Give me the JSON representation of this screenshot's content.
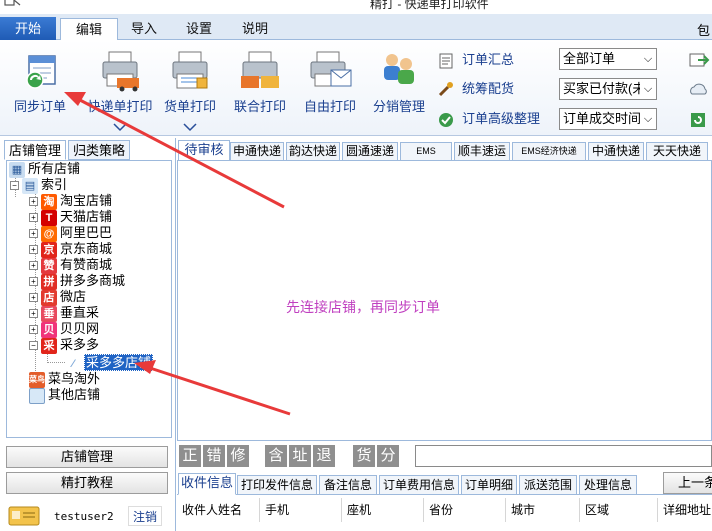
{
  "window": {
    "title": "精打 - 快递单打印软件"
  },
  "menubar": {
    "start": "开始",
    "tabs": [
      {
        "label": "编辑"
      },
      {
        "label": "导入"
      },
      {
        "label": "设置"
      },
      {
        "label": "说明"
      }
    ],
    "more": "包"
  },
  "ribbon": {
    "sync_order": "同步订单",
    "express_print": "快递单打印",
    "delivery_print": "货单打印",
    "combined_print": "联合打印",
    "free_print": "自由打印",
    "distribution": "分销管理",
    "order_summary": "订单汇总",
    "unified_picking": "统筹配货",
    "advanced_order": "订单高级整理",
    "filter_scope": "全部订单",
    "filter_status": "买家已付款(未",
    "filter_time": "订单成交时间,"
  },
  "left_panel": {
    "tabs": [
      "店铺管理",
      "归类策略"
    ],
    "tree": {
      "root": "所有店铺",
      "index": "索引",
      "shops": [
        {
          "label": "淘宝店铺",
          "icon": "taobao-icon",
          "glyph": "淘",
          "color": "#ff5a00"
        },
        {
          "label": "天猫店铺",
          "icon": "tmall-icon",
          "glyph": "T",
          "color": "#d40000"
        },
        {
          "label": "阿里巴巴",
          "icon": "alibaba-icon",
          "glyph": "@",
          "color": "#ff6a00"
        },
        {
          "label": "京东商城",
          "icon": "jd-icon",
          "glyph": "京",
          "color": "#e1251b"
        },
        {
          "label": "有赞商城",
          "icon": "youzan-icon",
          "glyph": "赞",
          "color": "#e4393c"
        },
        {
          "label": "拼多多商城",
          "icon": "pinduoduo-icon",
          "glyph": "拼",
          "color": "#e02e24"
        },
        {
          "label": "微店",
          "icon": "weidian-icon",
          "glyph": "店",
          "color": "#e23b2e"
        },
        {
          "label": "垂直采",
          "icon": "chuizhicai-icon",
          "glyph": "垂",
          "color": "#e84a5f"
        },
        {
          "label": "贝贝网",
          "icon": "beibei-icon",
          "glyph": "贝",
          "color": "#f0347a"
        },
        {
          "label": "采多多",
          "icon": "caiduoduo-icon",
          "glyph": "采",
          "color": "#e1251b"
        }
      ],
      "selected_child": "采多多店铺",
      "after": [
        {
          "label": "菜鸟淘外",
          "icon": "cainiao-icon",
          "glyph": "菜",
          "color": "#e35d2b"
        },
        {
          "label": "其他店铺",
          "icon": "other-shop-icon",
          "glyph": "",
          "color": "#d7e8f7"
        }
      ]
    },
    "shop_manage_btn": "店铺管理",
    "tutorial_btn": "精打教程",
    "username": "testuser2",
    "logout": "注销"
  },
  "main": {
    "order_tabs": [
      "待审核",
      "申通快递",
      "韵达快递",
      "圆通速递",
      "EMS",
      "顺丰速运",
      "EMS经济快递",
      "中通快递",
      "天天快递"
    ],
    "center_message": "先连接店铺，再同步订单",
    "quick_keys": [
      "正",
      "错",
      "修",
      "含",
      "址",
      "退",
      "货",
      "分"
    ],
    "detail_tabs": [
      "收件信息",
      "打印发件信息",
      "备注信息",
      "订单费用信息",
      "订单明细",
      "派送范围",
      "处理信息"
    ],
    "prev_btn": "上一条",
    "detail_headers": [
      "收件人姓名",
      "手机",
      "座机",
      "省份",
      "城市",
      "区域",
      "详细地址"
    ]
  },
  "colors": {
    "accent": "#1f63c4",
    "annotation": "#e83a3a",
    "message": "#c040c0"
  }
}
